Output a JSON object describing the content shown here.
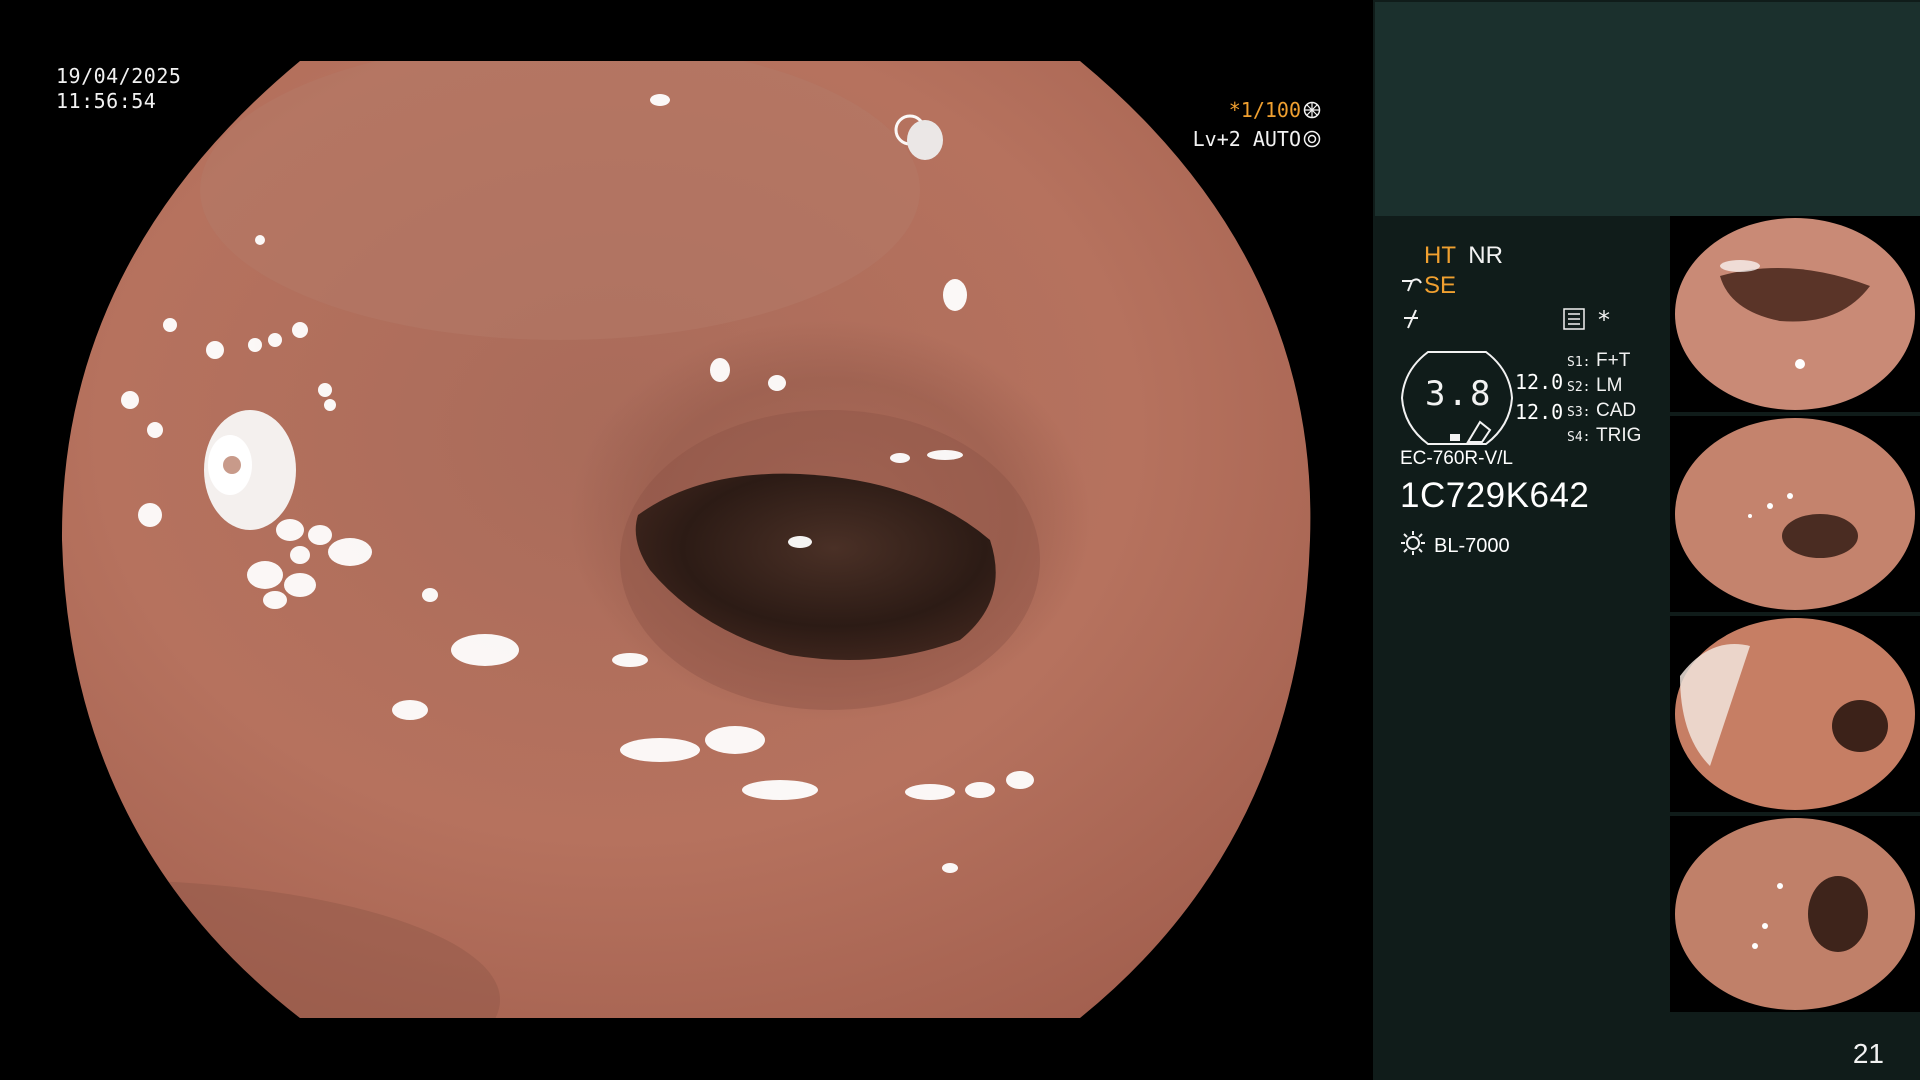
{
  "overlay": {
    "date": "19/04/2025",
    "time": "11:56:54",
    "shutter": "*1/100",
    "level": "Lv+2 AUTO"
  },
  "status": {
    "ht": "HT",
    "nr": "NR",
    "se": "SE",
    "star": "*",
    "gauge_value": "3.8",
    "value_1": "12.0",
    "value_2": "12.0",
    "switches": [
      {
        "key": "S1:",
        "value": "F+T"
      },
      {
        "key": "S2:",
        "value": "LM"
      },
      {
        "key": "S3:",
        "value": "CAD"
      },
      {
        "key": "S4:",
        "value": "TRIG"
      }
    ],
    "scope_model": "EC-760R-V/L",
    "scope_serial": "1C729K642",
    "light_source": "BL-7000"
  },
  "page_number": "21",
  "colors": {
    "accent_orange": "#f0a030",
    "panel_dark": "#101c1a",
    "panel_top": "#1b302d",
    "tissue": "#b8705c"
  },
  "icons": {
    "shutter": "aperture-icon",
    "level": "auto-iris-icon",
    "se": "scope-icon",
    "fn": "function-icon",
    "menu": "menu-list-icon",
    "light": "lamp-icon"
  }
}
